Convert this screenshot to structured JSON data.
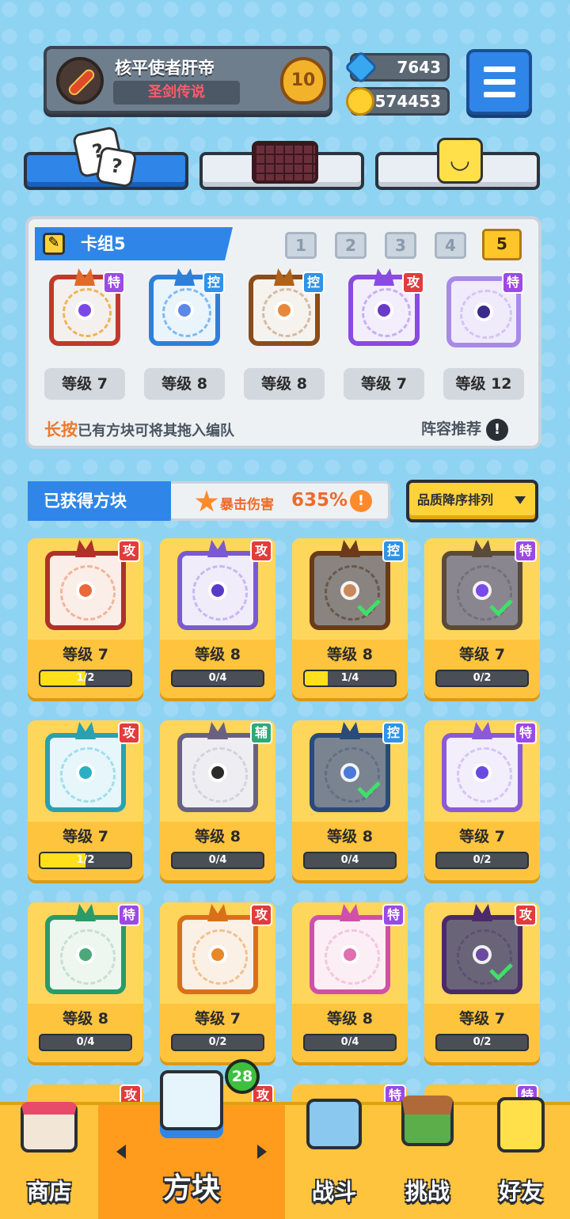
{
  "header": {
    "player_name": "核平使者肝帝",
    "player_title": "圣剑传说",
    "rank_level": "10",
    "gems": "7643",
    "coins": "574453",
    "menu_icon": "hamburger-icon"
  },
  "top_tabs": [
    {
      "icon": "dice-icon",
      "active": true
    },
    {
      "icon": "board-icon",
      "active": false
    },
    {
      "icon": "smiley-icon",
      "active": false
    }
  ],
  "deck": {
    "name": "卡组5",
    "tabs": [
      "1",
      "2",
      "3",
      "4",
      "5"
    ],
    "active_tab": "5",
    "cards": [
      {
        "badge": "特",
        "level": "等级 7"
      },
      {
        "badge": "控",
        "level": "等级 8"
      },
      {
        "badge": "控",
        "level": "等级 8"
      },
      {
        "badge": "攻",
        "level": "等级 7"
      },
      {
        "badge": "特",
        "level": "等级 12"
      }
    ],
    "hint_emphasis": "长按",
    "hint_rest": "已有方块可将其拖入编队",
    "recommend": "阵容推荐",
    "recommend_icon": "!"
  },
  "obtained": {
    "title": "已获得方块",
    "crit_label": "暴击伤害",
    "crit_value": "635%",
    "crit_icon": "!",
    "sort_label": "品质降序排列"
  },
  "blocks": [
    {
      "badge": "攻",
      "level": "等级 7",
      "progress": "1/2",
      "fill": 0.5,
      "equipped": false
    },
    {
      "badge": "攻",
      "level": "等级 8",
      "progress": "0/4",
      "fill": 0,
      "equipped": false
    },
    {
      "badge": "控",
      "level": "等级 8",
      "progress": "1/4",
      "fill": 0.25,
      "equipped": true
    },
    {
      "badge": "特",
      "level": "等级 7",
      "progress": "0/2",
      "fill": 0,
      "equipped": true
    },
    {
      "badge": "攻",
      "level": "等级 7",
      "progress": "1/2",
      "fill": 0.5,
      "equipped": false
    },
    {
      "badge": "辅",
      "level": "等级 8",
      "progress": "0/4",
      "fill": 0,
      "equipped": false
    },
    {
      "badge": "控",
      "level": "等级 8",
      "progress": "0/4",
      "fill": 0,
      "equipped": true
    },
    {
      "badge": "特",
      "level": "等级 7",
      "progress": "0/2",
      "fill": 0,
      "equipped": false
    },
    {
      "badge": "特",
      "level": "等级 8",
      "progress": "0/4",
      "fill": 0,
      "equipped": false
    },
    {
      "badge": "攻",
      "level": "等级 7",
      "progress": "0/2",
      "fill": 0,
      "equipped": false
    },
    {
      "badge": "特",
      "level": "等级 8",
      "progress": "0/4",
      "fill": 0,
      "equipped": false
    },
    {
      "badge": "攻",
      "level": "等级 7",
      "progress": "0/2",
      "fill": 0,
      "equipped": true
    }
  ],
  "partial_row_badges": [
    "攻",
    "攻",
    "特",
    "特"
  ],
  "nav": {
    "shop": "商店",
    "blocks": "方块",
    "blocks_count": "28",
    "battle": "战斗",
    "challenge": "挑战",
    "friends": "好友"
  },
  "colors": {
    "accent_blue": "#2f86e8",
    "card_yellow": "#ffc43d",
    "attack_red": "#e23c3c",
    "control_blue": "#2f93e8",
    "special_purple": "#9b4ae6",
    "support_green": "#2fa877"
  }
}
